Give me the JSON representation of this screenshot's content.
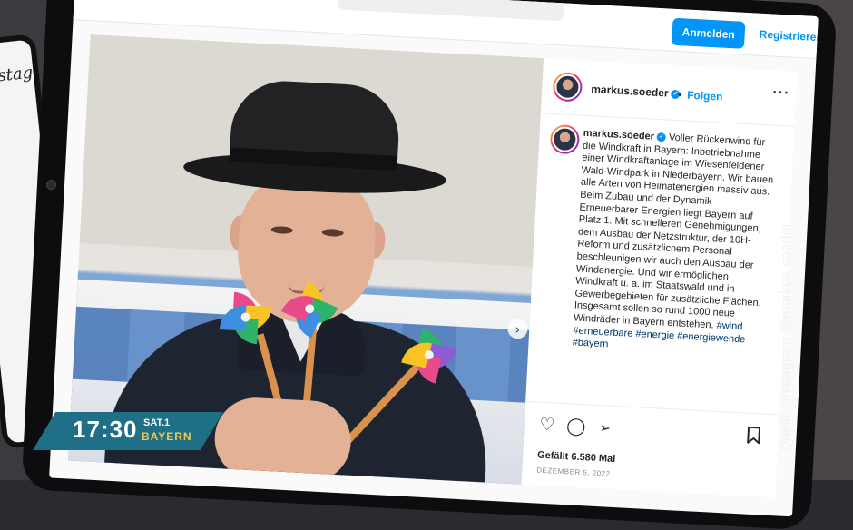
{
  "broadcast": {
    "time": "17:30",
    "channel": "SAT.1",
    "region": "BAYERN",
    "source_credit": "Quelle: Instagram @markus.soeder",
    "colors": {
      "logo_bg": "#1f6f86",
      "region_text": "#f1c84b"
    }
  },
  "background_phone": {
    "brand_text": "Instag"
  },
  "instagram": {
    "topbar": {
      "login_label": "Anmelden",
      "register_label": "Registrieren"
    },
    "post_header": {
      "username": "markus.soeder",
      "follow_label": "Folgen",
      "more_icon": "more-options-icon"
    },
    "caption": {
      "username": "markus.soeder",
      "text": "Voller Rückenwind für die Windkraft in Bayern: Inbetriebnahme einer Windkraftanlage im Wiesenfeldener Wald-Windpark in Niederbayern. Wir bauen alle Arten von Heimatenergien massiv aus. Beim Zubau und der Dynamik Erneuerbarer Energien liegt Bayern auf Platz 1. Mit schnelleren Genehmigungen, dem Ausbau der Netzstruktur, der 10H-Reform und zusätzlichem Personal beschleunigen wir auch den Ausbau der Windenergie. Und wir ermöglichen Windkraft u. a. im Staatswald und in Gewerbegebieten für zusätzliche Flächen. Insgesamt sollen so rund 1000 neue Windräder in Bayern entstehen.",
      "hashtags": "#wind #erneuerbare #energie #energiewende #bayern"
    },
    "actions": {
      "icons": [
        "heart-icon",
        "comment-icon",
        "share-icon",
        "bookmark-icon"
      ]
    },
    "likes": "Gefällt 6.580 Mal",
    "date": "DEZEMBER 5, 2022",
    "colors": {
      "accent": "#0095f6",
      "text": "#262626",
      "muted": "#8e8e8e"
    }
  }
}
